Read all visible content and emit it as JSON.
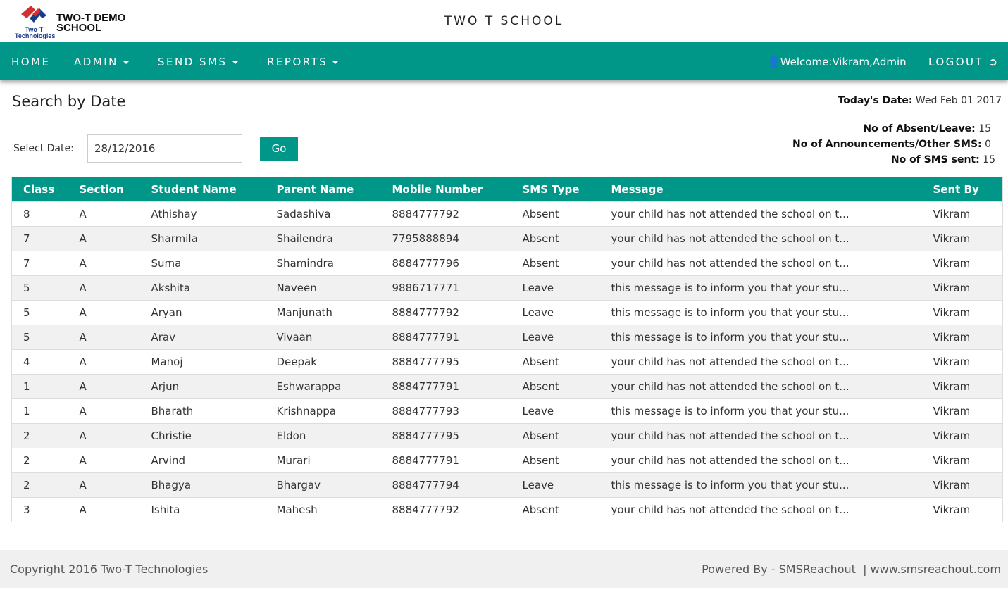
{
  "logo": {
    "company": "Two-T Technologies",
    "school": "TWO-T DEMO SCHOOL"
  },
  "header": {
    "title": "TWO T SCHOOL"
  },
  "nav": {
    "home": "HOME",
    "admin": "ADMIN",
    "send_sms": "SEND SMS",
    "reports": "REPORTS",
    "welcome": "Welcome:Vikram,Admin",
    "logout": "LOGOUT"
  },
  "page": {
    "title": "Search by Date",
    "today_label": "Today's Date:",
    "today_value": "Wed Feb 01 2017",
    "select_date_label": "Select Date:",
    "select_date_value": "28/12/2016",
    "go": "Go",
    "absent_label": "No of Absent/Leave:",
    "absent_value": "15",
    "announce_label": "No of Announcements/Other SMS:",
    "announce_value": "0",
    "sent_label": "No of SMS sent:",
    "sent_value": "15"
  },
  "table": {
    "headers": [
      "Class",
      "Section",
      "Student Name",
      "Parent Name",
      "Mobile Number",
      "SMS Type",
      "Message",
      "Sent By"
    ],
    "rows": [
      [
        "8",
        "A",
        "Athishay",
        "Sadashiva",
        "8884777792",
        "Absent",
        "your child has not attended the school on t...",
        "Vikram"
      ],
      [
        "7",
        "A",
        "Sharmila",
        "Shailendra",
        "7795888894",
        "Absent",
        "your child has not attended the school on t...",
        "Vikram"
      ],
      [
        "7",
        "A",
        "Suma",
        "Shamindra",
        "8884777796",
        "Absent",
        "your child has not attended the school on t...",
        "Vikram"
      ],
      [
        "5",
        "A",
        "Akshita",
        "Naveen",
        "9886717771",
        "Leave",
        "this message is to inform you that your stu...",
        "Vikram"
      ],
      [
        "5",
        "A",
        "Aryan",
        "Manjunath",
        "8884777792",
        "Leave",
        "this message is to inform you that your stu...",
        "Vikram"
      ],
      [
        "5",
        "A",
        "Arav",
        "Vivaan",
        "8884777791",
        "Leave",
        "this message is to inform you that your stu...",
        "Vikram"
      ],
      [
        "4",
        "A",
        "Manoj",
        "Deepak",
        "8884777795",
        "Absent",
        "your child has not attended the school on t...",
        "Vikram"
      ],
      [
        "1",
        "A",
        "Arjun",
        "Eshwarappa",
        "8884777791",
        "Absent",
        "your child has not attended the school on t...",
        "Vikram"
      ],
      [
        "1",
        "A",
        "Bharath",
        "Krishnappa",
        "8884777793",
        "Leave",
        "this message is to inform you that your stu...",
        "Vikram"
      ],
      [
        "2",
        "A",
        "Christie",
        "Eldon",
        "8884777795",
        "Absent",
        "your child has not attended the school on t...",
        "Vikram"
      ],
      [
        "2",
        "A",
        "Arvind",
        "Murari",
        "8884777791",
        "Absent",
        "your child has not attended the school on t...",
        "Vikram"
      ],
      [
        "2",
        "A",
        "Bhagya",
        "Bhargav",
        "8884777794",
        "Leave",
        "this message is to inform you that your stu...",
        "Vikram"
      ],
      [
        "3",
        "A",
        "Ishita",
        "Mahesh",
        "8884777792",
        "Absent",
        "your child has not attended the school on t...",
        "Vikram"
      ]
    ]
  },
  "footer": {
    "copyright": "Copyright 2016 Two-T Technologies",
    "powered": "Powered By - SMSReachout  | www.smsreachout.com"
  },
  "colors": {
    "primary": "#009688",
    "footer_bg": "#f0f0f0"
  }
}
